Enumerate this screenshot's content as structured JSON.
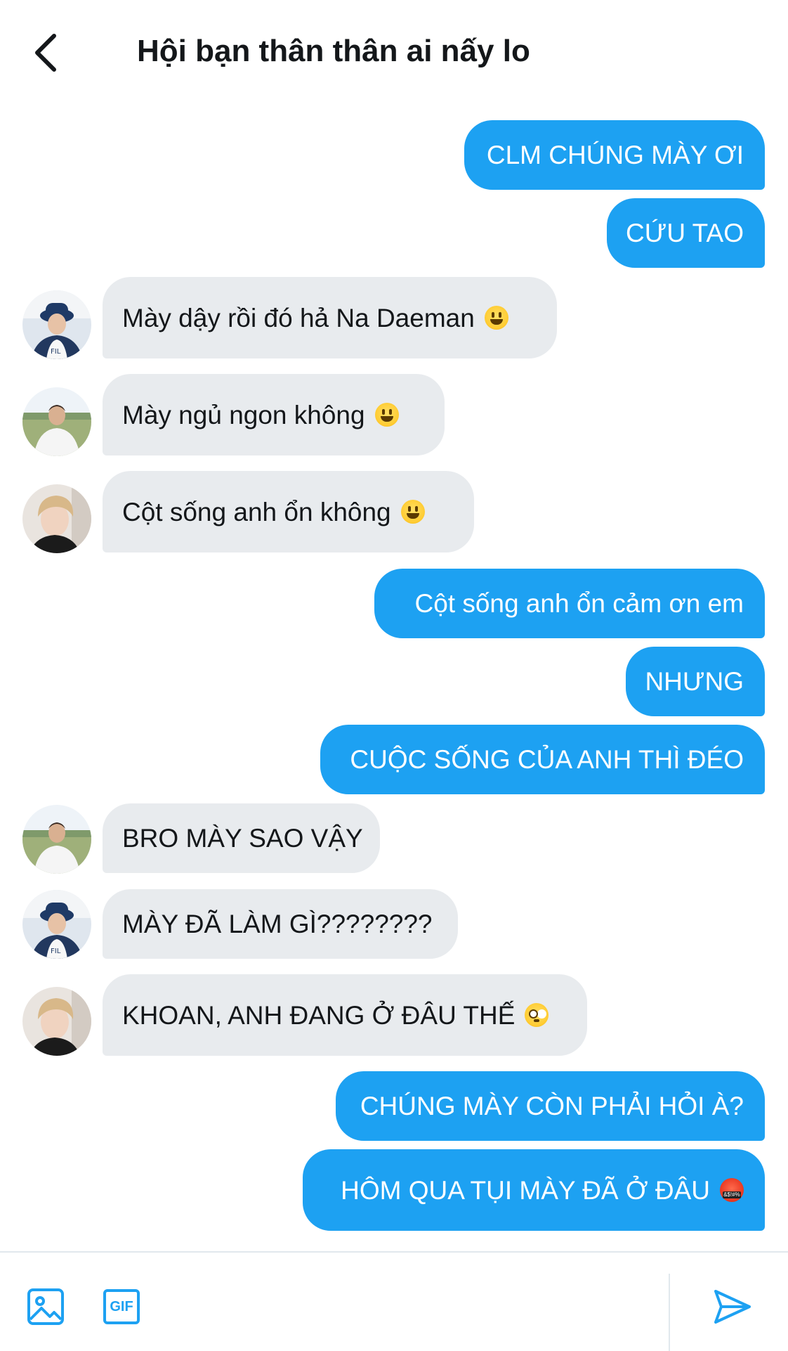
{
  "header": {
    "title": "Hội bạn thân thân ai nấy lo",
    "back_icon": "chevron-left-icon"
  },
  "colors": {
    "outgoing_bubble": "#1da1f2",
    "incoming_bubble": "#e8ebee",
    "accent": "#1da1f2"
  },
  "messages": [
    {
      "direction": "out",
      "text": "CLM CHÚNG MÀY ƠI"
    },
    {
      "direction": "out",
      "text": "CỨU TAO"
    },
    {
      "direction": "in",
      "avatar": "avatar-bucket-hat-icon",
      "text": "Mày dậy rồi đó hả Na Daeman",
      "emoji": "grinning-face-icon"
    },
    {
      "direction": "in",
      "avatar": "avatar-field-icon",
      "text": "Mày ngủ ngon không",
      "emoji": "grinning-face-icon"
    },
    {
      "direction": "in",
      "avatar": "avatar-blonde-icon",
      "text": "Cột sống anh ổn không",
      "emoji": "grinning-face-icon"
    },
    {
      "direction": "out",
      "text": "Cột sống anh ổn cảm ơn em"
    },
    {
      "direction": "out",
      "text": "NHƯNG"
    },
    {
      "direction": "out",
      "text": "CUỘC SỐNG CỦA ANH THÌ ĐÉO"
    },
    {
      "direction": "in",
      "avatar": "avatar-field-icon",
      "text": "BRO MÀY SAO VẬY"
    },
    {
      "direction": "in",
      "avatar": "avatar-bucket-hat-icon",
      "text": "MÀY ĐÃ LÀM GÌ????????"
    },
    {
      "direction": "in",
      "avatar": "avatar-blonde-icon",
      "text": "KHOAN, ANH ĐANG Ở ĐÂU THẾ",
      "emoji": "flushed-face-icon"
    },
    {
      "direction": "out",
      "text": "CHÚNG MÀY CÒN PHẢI HỎI À?"
    },
    {
      "direction": "out",
      "text": "HÔM QUA TỤI MÀY ĐÃ Ở ĐÂU",
      "emoji": "cursing-face-icon"
    }
  ],
  "composer": {
    "image_icon": "image-icon",
    "gif_label": "GIF",
    "send_icon": "send-icon"
  }
}
